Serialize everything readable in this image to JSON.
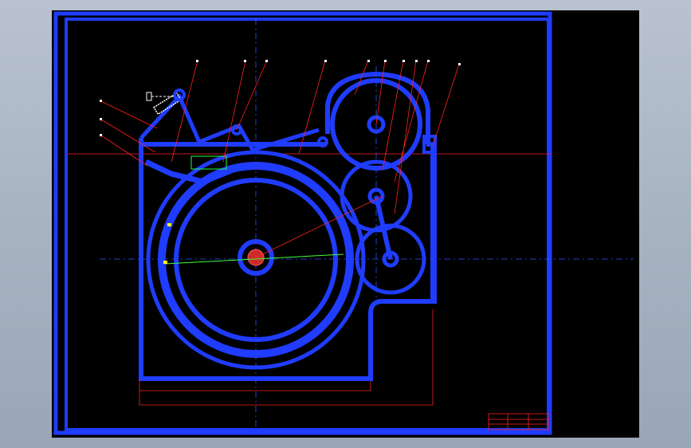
{
  "viewer": {
    "background": "#000000",
    "line_color": "#1f3cff",
    "leader_color": "#ff2020",
    "centerline_color": "#2a55ff"
  },
  "drawing": {
    "title_block_text": [
      "",
      "",
      ""
    ]
  }
}
